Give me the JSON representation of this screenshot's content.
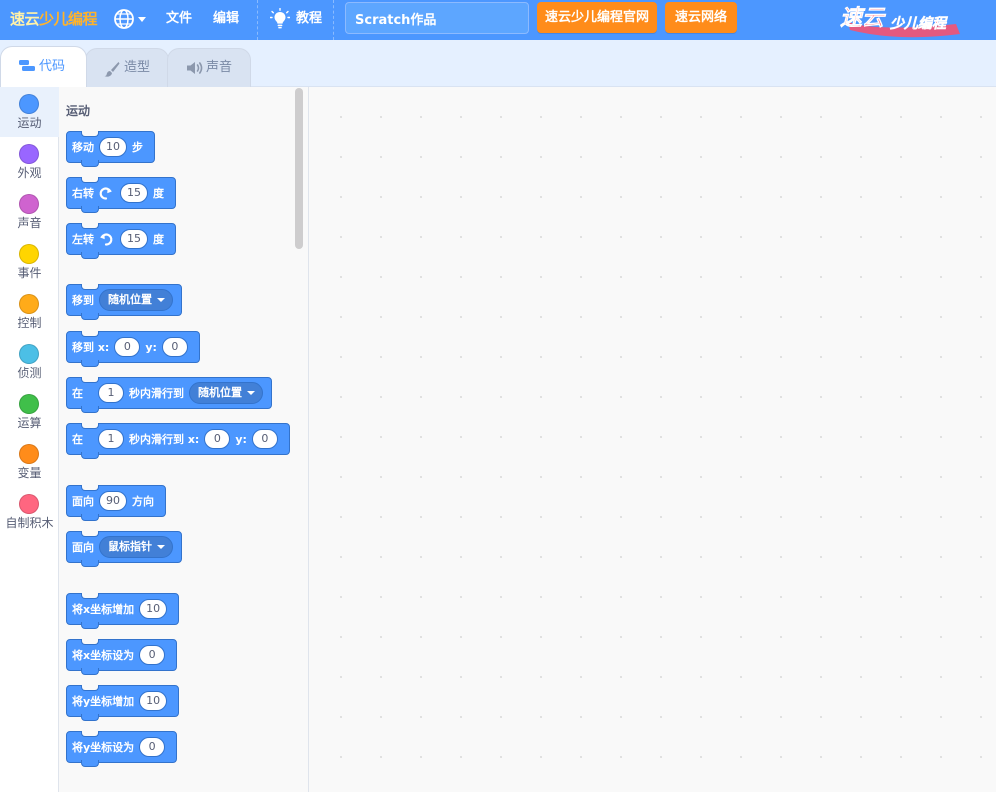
{
  "menubar": {
    "logo": {
      "part1": "速云",
      "part2": "少儿编程"
    },
    "file": "文件",
    "edit": "编辑",
    "tutorials": "教程",
    "project_title": "Scratch作品",
    "btn_official": "速云少儿编程官网",
    "btn_network": "速云网络",
    "brand_mark": "速云少儿编程",
    "colors": {
      "bar": "#4c97ff",
      "orange": "#ff8c1a"
    }
  },
  "tabs": [
    {
      "label": "代码",
      "icon": "code-icon"
    },
    {
      "label": "造型",
      "icon": "brush-icon"
    },
    {
      "label": "声音",
      "icon": "speaker-icon"
    }
  ],
  "categories": [
    {
      "label": "运动",
      "color": "#4c97ff"
    },
    {
      "label": "外观",
      "color": "#9966ff"
    },
    {
      "label": "声音",
      "color": "#cf63cf"
    },
    {
      "label": "事件",
      "color": "#ffd500"
    },
    {
      "label": "控制",
      "color": "#ffab19"
    },
    {
      "label": "侦测",
      "color": "#4cbfe6"
    },
    {
      "label": "运算",
      "color": "#40bf4a"
    },
    {
      "label": "变量",
      "color": "#ff8c1a"
    },
    {
      "label": "自制积木",
      "color": "#ff6680"
    }
  ],
  "palette": {
    "heading": "运动",
    "blocks": {
      "move": {
        "a": "移动",
        "n": "10",
        "b": "步"
      },
      "turn_right": {
        "a": "右转",
        "n": "15",
        "b": "度"
      },
      "turn_left": {
        "a": "左转",
        "n": "15",
        "b": "度"
      },
      "goto": {
        "a": "移到",
        "menu": "随机位置"
      },
      "goto_xy": {
        "a": "移到 x:",
        "x": "0",
        "b": "y:",
        "y": "0"
      },
      "glide": {
        "a": "在",
        "n": "1",
        "b": "秒内滑行到",
        "menu": "随机位置"
      },
      "glide_xy": {
        "a": "在",
        "n": "1",
        "b": "秒内滑行到 x:",
        "x": "0",
        "c": "y:",
        "y": "0"
      },
      "point_dir": {
        "a": "面向",
        "n": "90",
        "b": "方向"
      },
      "point_towards": {
        "a": "面向",
        "menu": "鼠标指针"
      },
      "change_x": {
        "a": "将x坐标增加",
        "n": "10"
      },
      "set_x": {
        "a": "将x坐标设为",
        "n": "0"
      },
      "change_y": {
        "a": "将y坐标增加",
        "n": "10"
      },
      "set_y": {
        "a": "将y坐标设为",
        "n": "0"
      }
    }
  }
}
